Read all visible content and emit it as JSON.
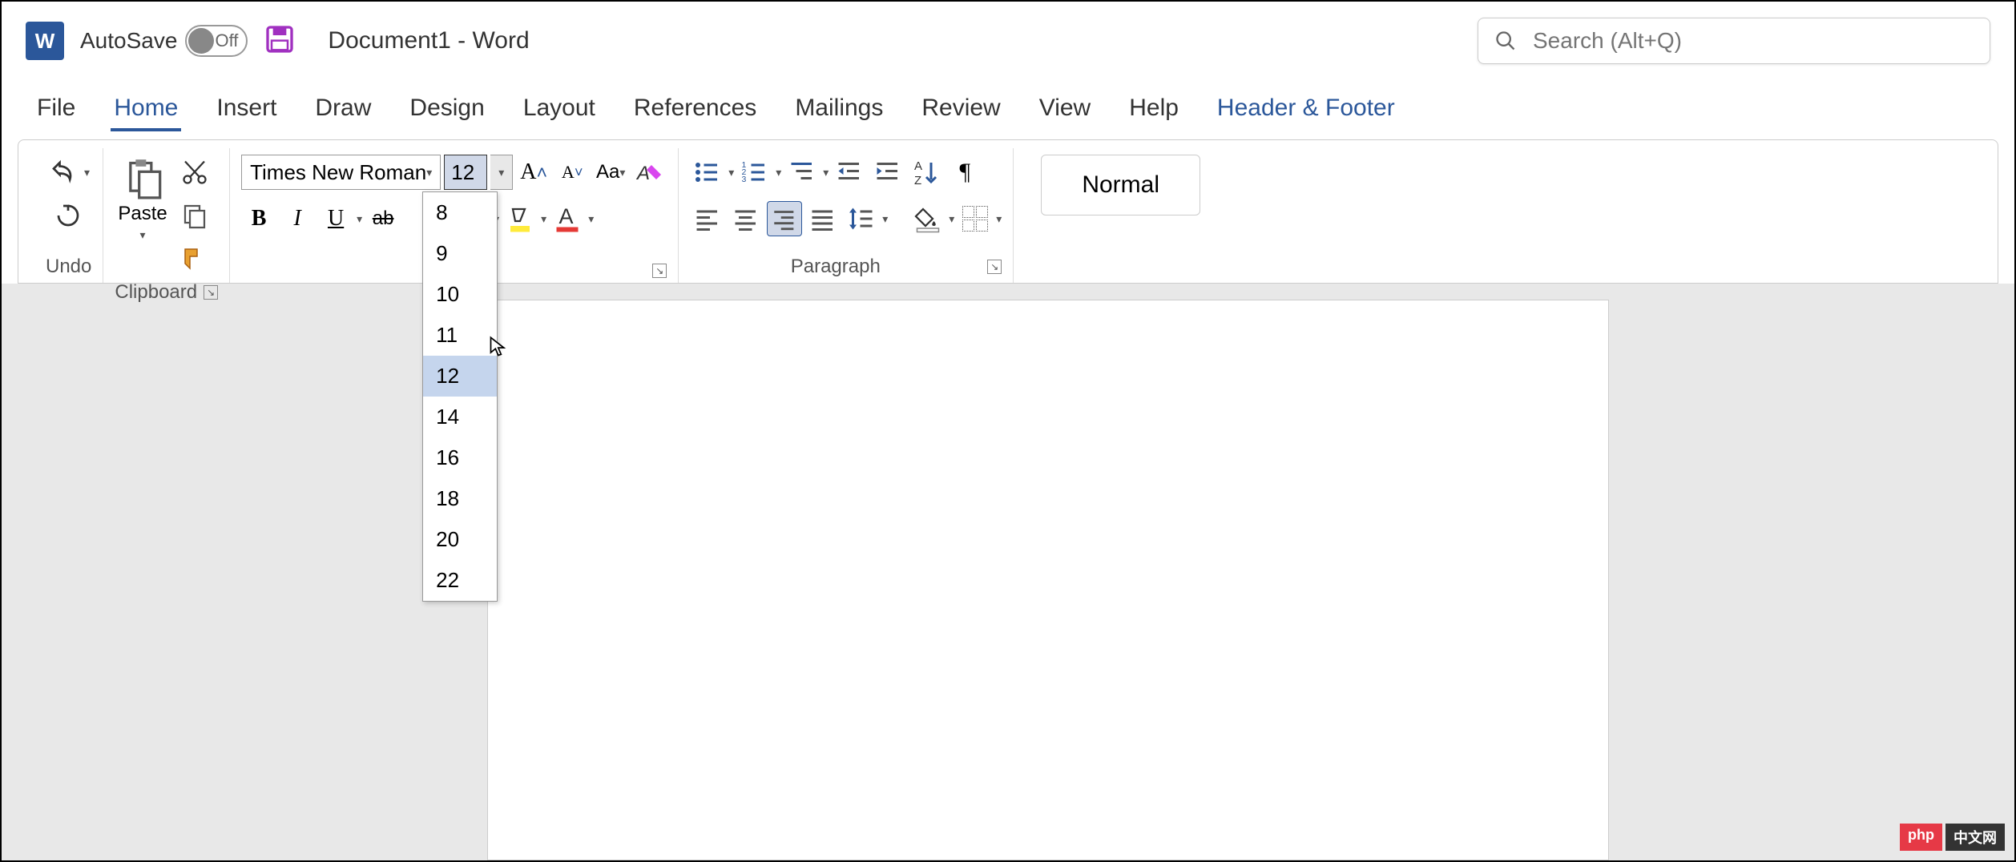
{
  "titlebar": {
    "autosave_label": "AutoSave",
    "autosave_state": "Off",
    "document_title": "Document1  -  Word"
  },
  "search": {
    "placeholder": "Search (Alt+Q)"
  },
  "tabs": {
    "file": "File",
    "home": "Home",
    "insert": "Insert",
    "draw": "Draw",
    "design": "Design",
    "layout": "Layout",
    "references": "References",
    "mailings": "Mailings",
    "review": "Review",
    "view": "View",
    "help": "Help",
    "context": "Header & Footer"
  },
  "ribbon": {
    "undo_label": "Undo",
    "clipboard_label": "Clipboard",
    "paste_label": "Paste",
    "font_name": "Times New Roman",
    "font_size": "12",
    "paragraph_label": "Paragraph",
    "style_normal": "Normal"
  },
  "font_sizes": [
    "8",
    "9",
    "10",
    "11",
    "12",
    "14",
    "16",
    "18",
    "20",
    "22"
  ],
  "watermark": {
    "php": "php",
    "cn": "中文网"
  }
}
